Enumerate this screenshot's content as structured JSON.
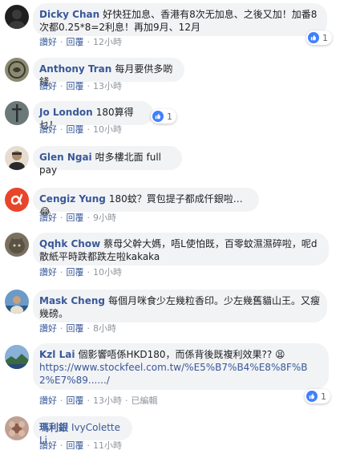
{
  "actions": {
    "like": "讚好",
    "reply": "回覆",
    "sep": "·"
  },
  "comments": [
    {
      "author": "Dicky Chan",
      "text": "好快狂加息、香港有8次无加息、之後又加！加番8次都0.25*8=2利息！再加9月、12月",
      "time": "12小時",
      "reactions": "1",
      "avatar_icon": "person-icon",
      "avatar_color": "#2a2a2a"
    },
    {
      "author": "Anthony Tran",
      "text": "每月要供多啲錢",
      "time": "13小時",
      "avatar_icon": "logo-icon",
      "avatar_color": "#8a8a6a"
    },
    {
      "author": "Jo London",
      "text": "180算得乜！",
      "time": "10小時",
      "reactions": "1",
      "avatar_icon": "cross-icon",
      "avatar_color": "#5a6a6a"
    },
    {
      "author": "Glen Ngai",
      "text": "咁多樓北面 full pay",
      "time": "",
      "avatar_icon": "person-icon",
      "avatar_color": "#b08a6a"
    },
    {
      "author": "Cengiz Yung",
      "text": "180蚊？買包提子都成仟銀啦…😂",
      "time": "9小時",
      "avatar_icon": "alpha-icon",
      "avatar_color": "#e8452a"
    },
    {
      "author": "Qqhk Chow",
      "text": "蔡母父幹大媽，唔L使怕既，百零蚊濕濕碎啦，呢d 散紙平時跌都跌左啦kakaka",
      "time": "10小時",
      "avatar_icon": "cat-icon",
      "avatar_color": "#7a7060"
    },
    {
      "author": "Mask Cheng",
      "text": "每個月咪食少左幾粒香印。少左幾舊貓山王。又瘦幾磅。",
      "time": "8小時",
      "avatar_icon": "person-icon",
      "avatar_color": "#3a5a8a"
    },
    {
      "author": "Kzl Lai",
      "text": "個影響唔係HKD180，而係背後既複利效果?? 😫",
      "link": "https://www.stockfeel.com.tw/%E5%B7%B4%E8%8F%B2%E7%89....../",
      "time": "13小時",
      "edited": "已編輯",
      "reactions": "1",
      "avatar_icon": "landscape-icon",
      "avatar_color": "#4a7ab0"
    },
    {
      "author": "瑪利銀",
      "text": "IvyColette Li",
      "time": "11小時",
      "avatar_icon": "flower-icon",
      "avatar_color": "#a08070"
    }
  ]
}
